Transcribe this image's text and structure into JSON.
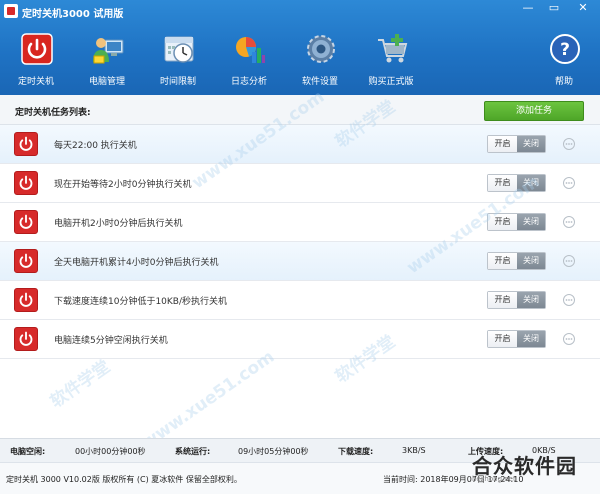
{
  "window": {
    "title": "定时关机3000 试用版",
    "controls": {
      "minimize": "—",
      "maximize": "▭",
      "close": "✕"
    }
  },
  "toolbar": [
    {
      "label": "定时关机",
      "icon": "power-icon"
    },
    {
      "label": "电脑管理",
      "icon": "computer-manage-icon"
    },
    {
      "label": "时间限制",
      "icon": "clock-icon"
    },
    {
      "label": "日志分析",
      "icon": "chart-icon"
    },
    {
      "label": "软件设置",
      "icon": "settings-gear-icon"
    },
    {
      "label": "购买正式版",
      "icon": "cart-icon"
    },
    {
      "label": "帮助",
      "icon": "help-icon"
    }
  ],
  "list": {
    "title": "定时关机任务列表:",
    "add_button": "添加任务",
    "toggle_on": "开启",
    "toggle_off": "关闭",
    "tasks": [
      {
        "text": "每天22:00 执行关机"
      },
      {
        "text": "现在开始等待2小时0分钟执行关机"
      },
      {
        "text": "电脑开机2小时0分钟后执行关机"
      },
      {
        "text": "全天电脑开机累计4小时0分钟后执行关机"
      },
      {
        "text": "下载速度连续10分钟低于10KB/秒执行关机"
      },
      {
        "text": "电脑连续5分钟空闲执行关机"
      }
    ]
  },
  "status": {
    "idle_label": "电脑空闲:",
    "idle_value": "00小时00分钟00秒",
    "run_label": "系统运行:",
    "run_value": "09小时05分钟00秒",
    "down_label": "下载速度:",
    "down_value": "3KB/S",
    "up_label": "上传速度:",
    "up_value": "0KB/S"
  },
  "footer": {
    "copyright": "定时关机 3000 V10.02版  版权所有 (C)  夏冰软件 保留全部权利。",
    "time": "当前时间:  2018年09月07日 17:24:10"
  },
  "watermarks": [
    "软件学堂",
    "www.xue51.com"
  ],
  "brand": {
    "text": "合众软件园",
    "url": "hezhong.net"
  },
  "colors": {
    "header": "#1f73c4",
    "accent_green": "#4ea628",
    "power_red": "#d72a2a"
  }
}
